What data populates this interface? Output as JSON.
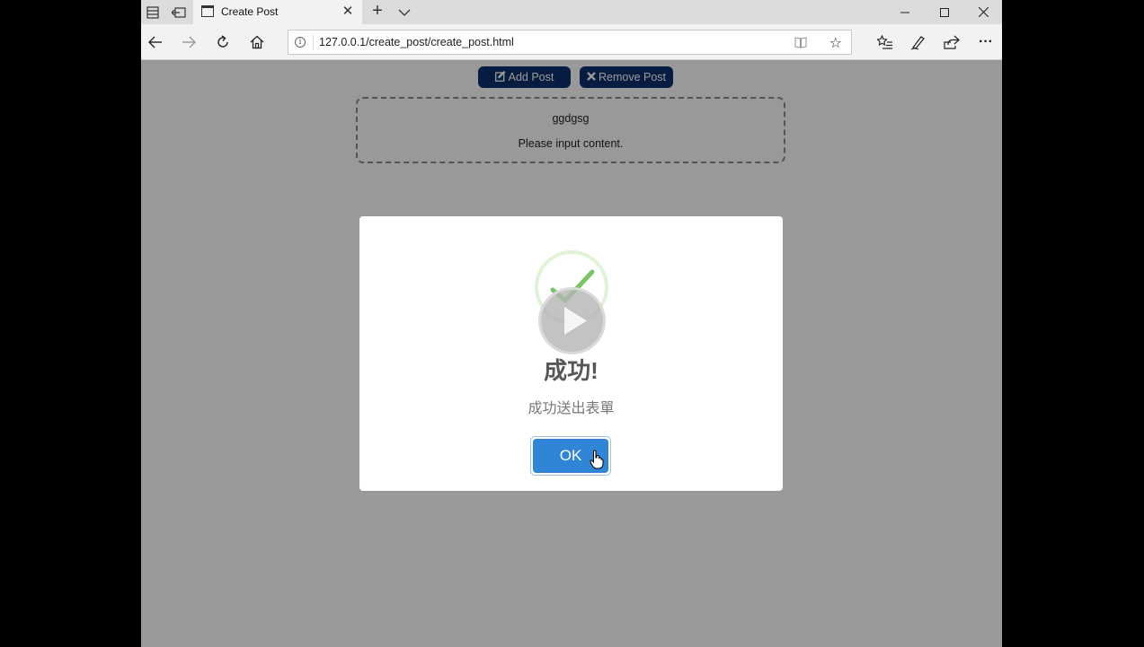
{
  "browser": {
    "tab_title": "Create Post",
    "new_tab_symbol": "+",
    "tab_close_symbol": "✕",
    "url": "127.0.0.1/create_post/create_post.html",
    "info_symbol": "i",
    "star_symbol": "☆",
    "more_symbol": "···"
  },
  "toolbar": {
    "add_post_label": "Add Post",
    "remove_post_label": "Remove Post",
    "add_post_icon": "edit-icon",
    "remove_post_icon": "close-icon"
  },
  "post": {
    "title": "ggdgsg",
    "content": "Please input content."
  },
  "modal": {
    "title": "成功!",
    "text": "成功送出表單",
    "ok_label": "OK",
    "icon": "success-check-icon",
    "accent": "#3085d6"
  }
}
